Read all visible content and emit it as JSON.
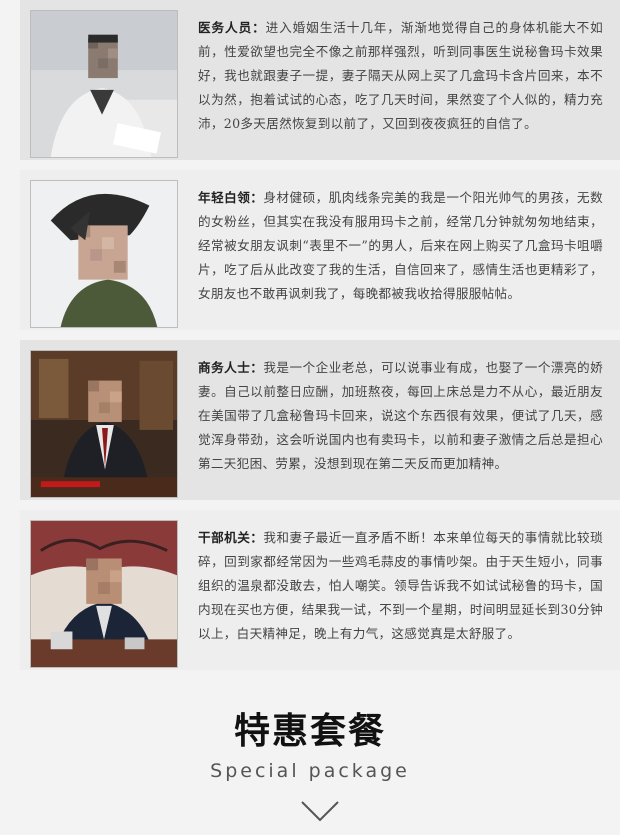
{
  "testimonials": [
    {
      "label": "医务人员：",
      "text": "进入婚姻生活十几年，渐渐地觉得自己的身体机能大不如前，性爱欲望也完全不像之前那样强烈，听到同事医生说秘鲁玛卡效果好，我也就跟妻子一提，妻子隔天从网上买了几盒玛卡含片回来，本不以为然，抱着试试的心态，吃了几天时间，果然变了个人似的，精力充沛，20多天居然恢复到以前了，又回到夜夜疯狂的自信了。"
    },
    {
      "label": "年轻白领：",
      "text": "身材健硕，肌肉线条完美的我是一个阳光帅气的男孩，无数的女粉丝，但其实在我没有服用玛卡之前，经常几分钟就匆匆地结束，经常被女朋友讽刺“表里不一”的男人，后来在网上购买了几盒玛卡咀嚼片，吃了后从此改变了我的生活，自信回来了，感情生活也更精彩了，女朋友也不敢再讽刺我了，每晚都被我收拾得服服帖帖。"
    },
    {
      "label": "商务人士：",
      "text": "我是一个企业老总，可以说事业有成，也娶了一个漂亮的娇妻。自己以前整日应酬，加班熬夜，每回上床总是力不从心，最近朋友在美国带了几盒秘鲁玛卡回来，说这个东西很有效果，便试了几天，感觉浑身带劲，这会听说国内也有卖玛卡，以前和妻子激情之后总是担心第二天犯困、劳累，没想到现在第二天反而更加精神。"
    },
    {
      "label": "干部机关：",
      "text": "我和妻子最近一直矛盾不断！本来单位每天的事情就比较琐碎，回到家都经常因为一些鸡毛蒜皮的事情吵架。由于天生短小，同事组织的温泉都没敢去，怕人嘲笑。领导告诉我不如试试秘鲁的玛卡，国内现在买也方便，结果我一试，不到一个星期，时间明显延长到30分钟以上，白天精神足，晚上有力气，这感觉真是太舒服了。"
    }
  ],
  "section": {
    "title": "特惠套餐",
    "subtitle": "Special package"
  }
}
